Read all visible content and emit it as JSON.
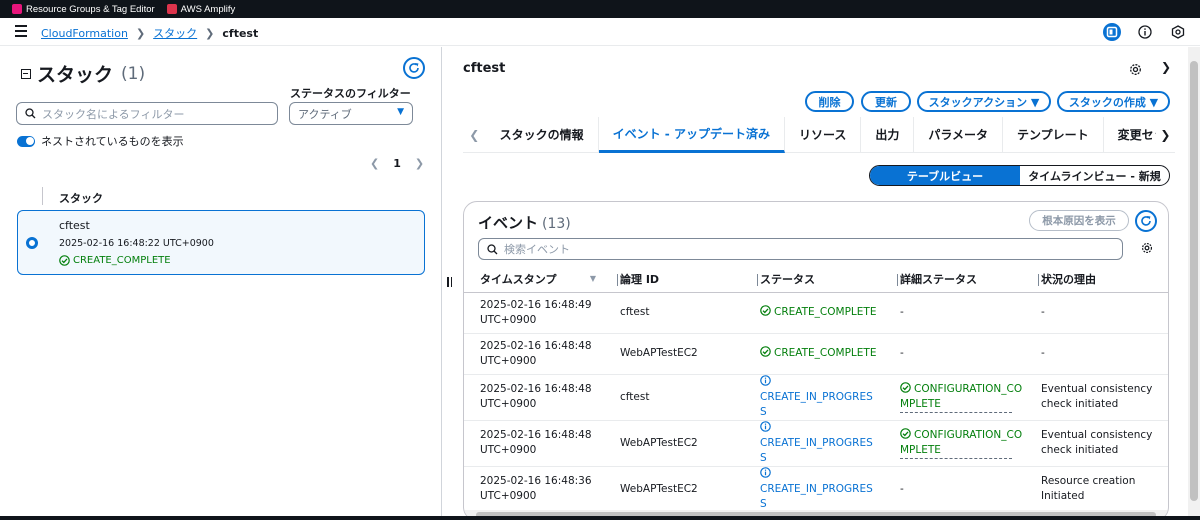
{
  "topbar": {
    "services": [
      {
        "label": "Resource Groups & Tag Editor",
        "color": "#e7157b"
      },
      {
        "label": "AWS Amplify",
        "color": "#dd344c"
      }
    ]
  },
  "breadcrumb": {
    "items": [
      "CloudFormation",
      "スタック",
      "cftest"
    ]
  },
  "left": {
    "title": "スタック",
    "count": "(1)",
    "search_placeholder": "スタック名によるフィルター",
    "status_filter_label": "ステータスのフィルター",
    "status_filter_value": "アクティブ",
    "nested_toggle_label": "ネストされているものを表示",
    "page_number": "1",
    "column_header": "スタック",
    "stack": {
      "name": "cftest",
      "timestamp": "2025-02-16 16:48:22 UTC+0900",
      "status": "CREATE_COMPLETE"
    }
  },
  "right": {
    "title": "cftest",
    "buttons": {
      "delete": "削除",
      "update": "更新",
      "actions": "スタックアクション ▼",
      "create": "スタックの作成 ▼"
    },
    "tabs": [
      "スタックの情報",
      "イベント - アップデート済み",
      "リソース",
      "出力",
      "パラメータ",
      "テンプレート",
      "変更セット"
    ],
    "view_toggle": {
      "table": "テーブルビュー",
      "timeline": "タイムラインビュー - 新規"
    },
    "events": {
      "title": "イベント",
      "count": "(13)",
      "root_cause_button": "根本原因を表示",
      "search_placeholder": "検索イベント",
      "columns": [
        "タイムスタンプ",
        "論理 ID",
        "ステータス",
        "詳細ステータス",
        "状況の理由"
      ],
      "rows": [
        {
          "ts1": "2025-02-16 16:48:49",
          "ts2": "UTC+0900",
          "logical": "cftest",
          "status1": "CREATE_COMPLETE",
          "status2": "",
          "status_kind": "ok",
          "detail1": "-",
          "detail2": "",
          "reason1": "-",
          "reason2": ""
        },
        {
          "ts1": "2025-02-16 16:48:48",
          "ts2": "UTC+0900",
          "logical": "WebAPTestEC2",
          "status1": "CREATE_COMPLETE",
          "status2": "",
          "status_kind": "ok",
          "detail1": "-",
          "detail2": "",
          "reason1": "-",
          "reason2": ""
        },
        {
          "ts1": "2025-02-16 16:48:48",
          "ts2": "UTC+0900",
          "logical": "cftest",
          "status1": "CREATE_IN_PROGRES",
          "status2": "S",
          "status_kind": "info",
          "detail1": "CONFIGURATION_CO",
          "detail2": "MPLETE",
          "reason1": "Eventual consistency",
          "reason2": "check initiated"
        },
        {
          "ts1": "2025-02-16 16:48:48",
          "ts2": "UTC+0900",
          "logical": "WebAPTestEC2",
          "status1": "CREATE_IN_PROGRES",
          "status2": "S",
          "status_kind": "info",
          "detail1": "CONFIGURATION_CO",
          "detail2": "MPLETE",
          "reason1": "Eventual consistency",
          "reason2": "check initiated"
        },
        {
          "ts1": "2025-02-16 16:48:36",
          "ts2": "UTC+0900",
          "logical": "WebAPTestEC2",
          "status1": "CREATE_IN_PROGRES",
          "status2": "S",
          "status_kind": "info",
          "detail1": "-",
          "detail2": "",
          "reason1": "Resource creation",
          "reason2": "Initiated"
        }
      ]
    }
  }
}
